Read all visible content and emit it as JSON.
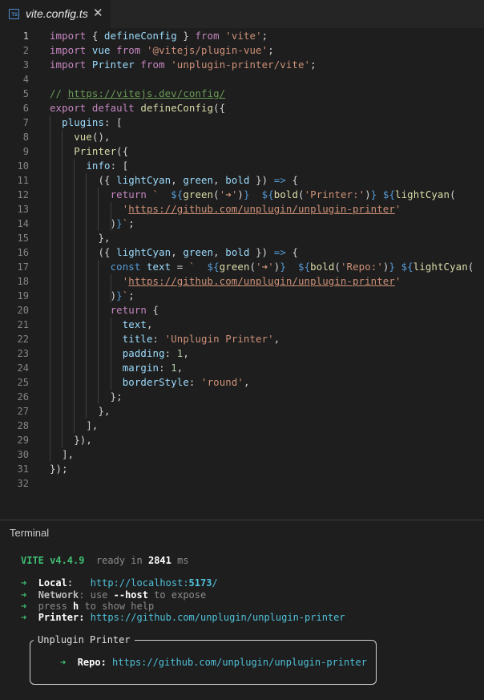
{
  "tab": {
    "icon_text": "TS",
    "title": "vite.config.ts",
    "close": "✕"
  },
  "editor": {
    "active_line": 1,
    "lines": [
      {
        "n": "1",
        "indent": 0,
        "t": [
          [
            "kw",
            "import"
          ],
          [
            "pun",
            " { "
          ],
          [
            "id",
            "defineConfig"
          ],
          [
            "pun",
            " } "
          ],
          [
            "kw",
            "from"
          ],
          [
            "pun",
            " "
          ],
          [
            "str",
            "'vite'"
          ],
          [
            "pun",
            ";"
          ]
        ]
      },
      {
        "n": "2",
        "indent": 0,
        "t": [
          [
            "kw",
            "import"
          ],
          [
            "pun",
            " "
          ],
          [
            "id",
            "vue"
          ],
          [
            "pun",
            " "
          ],
          [
            "kw",
            "from"
          ],
          [
            "pun",
            " "
          ],
          [
            "str",
            "'@vitejs/plugin-vue'"
          ],
          [
            "pun",
            ";"
          ]
        ]
      },
      {
        "n": "3",
        "indent": 0,
        "t": [
          [
            "kw",
            "import"
          ],
          [
            "pun",
            " "
          ],
          [
            "id",
            "Printer"
          ],
          [
            "pun",
            " "
          ],
          [
            "kw",
            "from"
          ],
          [
            "pun",
            " "
          ],
          [
            "str",
            "'unplugin-printer/vite'"
          ],
          [
            "pun",
            ";"
          ]
        ]
      },
      {
        "n": "4",
        "indent": 0,
        "t": []
      },
      {
        "n": "5",
        "indent": 0,
        "t": [
          [
            "cm",
            "// "
          ],
          [
            "cm lnk",
            "https://vitejs.dev/config/"
          ]
        ]
      },
      {
        "n": "6",
        "indent": 0,
        "t": [
          [
            "kw",
            "export"
          ],
          [
            "pun",
            " "
          ],
          [
            "kw",
            "default"
          ],
          [
            "pun",
            " "
          ],
          [
            "fn",
            "defineConfig"
          ],
          [
            "pun",
            "({"
          ]
        ]
      },
      {
        "n": "7",
        "indent": 1,
        "t": [
          [
            "pun",
            "  "
          ],
          [
            "id",
            "plugins"
          ],
          [
            "pun",
            ": ["
          ]
        ]
      },
      {
        "n": "8",
        "indent": 2,
        "t": [
          [
            "pun",
            "    "
          ],
          [
            "fn",
            "vue"
          ],
          [
            "pun",
            "(),"
          ]
        ]
      },
      {
        "n": "9",
        "indent": 2,
        "t": [
          [
            "pun",
            "    "
          ],
          [
            "fn",
            "Printer"
          ],
          [
            "pun",
            "({"
          ]
        ]
      },
      {
        "n": "10",
        "indent": 3,
        "t": [
          [
            "pun",
            "      "
          ],
          [
            "id",
            "info"
          ],
          [
            "pun",
            ": ["
          ]
        ]
      },
      {
        "n": "11",
        "indent": 4,
        "t": [
          [
            "pun",
            "        ({ "
          ],
          [
            "id",
            "lightCyan"
          ],
          [
            "pun",
            ", "
          ],
          [
            "id",
            "green"
          ],
          [
            "pun",
            ", "
          ],
          [
            "id",
            "bold"
          ],
          [
            "pun",
            " }) "
          ],
          [
            "kb",
            "=>"
          ],
          [
            "pun",
            " {"
          ]
        ]
      },
      {
        "n": "12",
        "indent": 5,
        "t": [
          [
            "pun",
            "          "
          ],
          [
            "kw",
            "return"
          ],
          [
            "pun",
            " "
          ],
          [
            "str",
            "`  "
          ],
          [
            "kb",
            "${"
          ],
          [
            "fn",
            "green"
          ],
          [
            "pun",
            "("
          ],
          [
            "str",
            "'➜'"
          ],
          [
            "pun",
            ")"
          ],
          [
            "kb",
            "}"
          ],
          [
            "str",
            "  "
          ],
          [
            "kb",
            "${"
          ],
          [
            "fn",
            "bold"
          ],
          [
            "pun",
            "("
          ],
          [
            "str",
            "'Printer:'"
          ],
          [
            "pun",
            ")"
          ],
          [
            "kb",
            "}"
          ],
          [
            "str",
            " "
          ],
          [
            "kb",
            "${"
          ],
          [
            "fn",
            "lightCyan"
          ],
          [
            "pun",
            "("
          ]
        ]
      },
      {
        "n": "13",
        "indent": 6,
        "t": [
          [
            "pun",
            "            "
          ],
          [
            "str",
            "'"
          ],
          [
            "str lnk",
            "https://github.com/unplugin/unplugin-printer"
          ],
          [
            "str",
            "'"
          ]
        ]
      },
      {
        "n": "14",
        "indent": 6,
        "t": [
          [
            "pun",
            "          )"
          ],
          [
            "kb",
            "}"
          ],
          [
            "str",
            "`"
          ],
          [
            "pun",
            ";"
          ]
        ]
      },
      {
        "n": "15",
        "indent": 4,
        "t": [
          [
            "pun",
            "        },"
          ]
        ]
      },
      {
        "n": "16",
        "indent": 4,
        "t": [
          [
            "pun",
            "        ({ "
          ],
          [
            "id",
            "lightCyan"
          ],
          [
            "pun",
            ", "
          ],
          [
            "id",
            "green"
          ],
          [
            "pun",
            ", "
          ],
          [
            "id",
            "bold"
          ],
          [
            "pun",
            " }) "
          ],
          [
            "kb",
            "=>"
          ],
          [
            "pun",
            " {"
          ]
        ]
      },
      {
        "n": "17",
        "indent": 5,
        "t": [
          [
            "pun",
            "          "
          ],
          [
            "kb",
            "const"
          ],
          [
            "pun",
            " "
          ],
          [
            "id",
            "text"
          ],
          [
            "pun",
            " = "
          ],
          [
            "str",
            "`  "
          ],
          [
            "kb",
            "${"
          ],
          [
            "fn",
            "green"
          ],
          [
            "pun",
            "("
          ],
          [
            "str",
            "'➜'"
          ],
          [
            "pun",
            ")"
          ],
          [
            "kb",
            "}"
          ],
          [
            "str",
            "  "
          ],
          [
            "kb",
            "${"
          ],
          [
            "fn",
            "bold"
          ],
          [
            "pun",
            "("
          ],
          [
            "str",
            "'Repo:'"
          ],
          [
            "pun",
            ")"
          ],
          [
            "kb",
            "}"
          ],
          [
            "str",
            " "
          ],
          [
            "kb",
            "${"
          ],
          [
            "fn",
            "lightCyan"
          ],
          [
            "pun",
            "("
          ]
        ]
      },
      {
        "n": "18",
        "indent": 6,
        "t": [
          [
            "pun",
            "            "
          ],
          [
            "str",
            "'"
          ],
          [
            "str lnk",
            "https://github.com/unplugin/unplugin-printer"
          ],
          [
            "str",
            "'"
          ]
        ]
      },
      {
        "n": "19",
        "indent": 6,
        "t": [
          [
            "pun",
            "          )"
          ],
          [
            "kb",
            "}"
          ],
          [
            "str",
            "`"
          ],
          [
            "pun",
            ";"
          ]
        ]
      },
      {
        "n": "20",
        "indent": 5,
        "t": [
          [
            "pun",
            "          "
          ],
          [
            "kw",
            "return"
          ],
          [
            "pun",
            " {"
          ]
        ]
      },
      {
        "n": "21",
        "indent": 6,
        "t": [
          [
            "pun",
            "            "
          ],
          [
            "id",
            "text"
          ],
          [
            "pun",
            ","
          ]
        ]
      },
      {
        "n": "22",
        "indent": 6,
        "t": [
          [
            "pun",
            "            "
          ],
          [
            "id",
            "title"
          ],
          [
            "pun",
            ": "
          ],
          [
            "str",
            "'Unplugin Printer'"
          ],
          [
            "pun",
            ","
          ]
        ]
      },
      {
        "n": "23",
        "indent": 6,
        "t": [
          [
            "pun",
            "            "
          ],
          [
            "id",
            "padding"
          ],
          [
            "pun",
            ": "
          ],
          [
            "num",
            "1"
          ],
          [
            "pun",
            ","
          ]
        ]
      },
      {
        "n": "24",
        "indent": 6,
        "t": [
          [
            "pun",
            "            "
          ],
          [
            "id",
            "margin"
          ],
          [
            "pun",
            ": "
          ],
          [
            "num",
            "1"
          ],
          [
            "pun",
            ","
          ]
        ]
      },
      {
        "n": "25",
        "indent": 6,
        "t": [
          [
            "pun",
            "            "
          ],
          [
            "id",
            "borderStyle"
          ],
          [
            "pun",
            ": "
          ],
          [
            "str",
            "'round'"
          ],
          [
            "pun",
            ","
          ]
        ]
      },
      {
        "n": "26",
        "indent": 5,
        "t": [
          [
            "pun",
            "          };"
          ]
        ]
      },
      {
        "n": "27",
        "indent": 4,
        "t": [
          [
            "pun",
            "        },"
          ]
        ]
      },
      {
        "n": "28",
        "indent": 3,
        "t": [
          [
            "pun",
            "      ],"
          ]
        ]
      },
      {
        "n": "29",
        "indent": 2,
        "t": [
          [
            "pun",
            "    }),"
          ]
        ]
      },
      {
        "n": "30",
        "indent": 1,
        "t": [
          [
            "pun",
            "  ],"
          ]
        ]
      },
      {
        "n": "31",
        "indent": 0,
        "t": [
          [
            "pun",
            "});"
          ]
        ]
      },
      {
        "n": "32",
        "indent": 0,
        "t": []
      }
    ]
  },
  "terminal": {
    "title": "Terminal",
    "lines": [
      {
        "t": [
          [
            "gb",
            "VITE v4.4.9"
          ],
          [
            "d",
            "  ready in "
          ],
          [
            "wb",
            "2841"
          ],
          [
            "d",
            " ms"
          ]
        ]
      },
      {
        "t": []
      },
      {
        "t": [
          [
            "g",
            "➜"
          ],
          [
            "w",
            "  "
          ],
          [
            "wb",
            "Local"
          ],
          [
            "w",
            ":   "
          ],
          [
            "c",
            "http://localhost:"
          ],
          [
            "cb",
            "5173"
          ],
          [
            "c",
            "/"
          ]
        ]
      },
      {
        "t": [
          [
            "g",
            "➜"
          ],
          [
            "d",
            "  "
          ],
          [
            "db",
            "Network"
          ],
          [
            "d",
            ": use "
          ],
          [
            "wb",
            "--host"
          ],
          [
            "d",
            " to expose"
          ]
        ]
      },
      {
        "t": [
          [
            "g",
            "➜"
          ],
          [
            "d",
            "  press "
          ],
          [
            "wb",
            "h"
          ],
          [
            "d",
            " to show help"
          ]
        ]
      },
      {
        "t": [
          [
            "g",
            "➜"
          ],
          [
            "w",
            "  "
          ],
          [
            "wb",
            "Printer:"
          ],
          [
            "w",
            " "
          ],
          [
            "c",
            "https://github.com/unplugin/unplugin-printer"
          ]
        ]
      }
    ],
    "box": {
      "title": "Unplugin Printer",
      "line": [
        [
          "g",
          "➜"
        ],
        [
          "w",
          "  "
        ],
        [
          "wb",
          "Repo:"
        ],
        [
          "w",
          " "
        ],
        [
          "c",
          "https://github.com/unplugin/unplugin-printer"
        ]
      ]
    }
  },
  "colors": {
    "background": "#1e1e1e",
    "tabbar": "#252526",
    "keyword": "#c586c0",
    "string": "#ce9178",
    "function": "#dcdcaa",
    "variable": "#9cdcfe",
    "comment": "#6a9955",
    "number": "#b5cea8",
    "terminal_green": "#3fbd72",
    "terminal_cyan": "#4fc1d9"
  }
}
